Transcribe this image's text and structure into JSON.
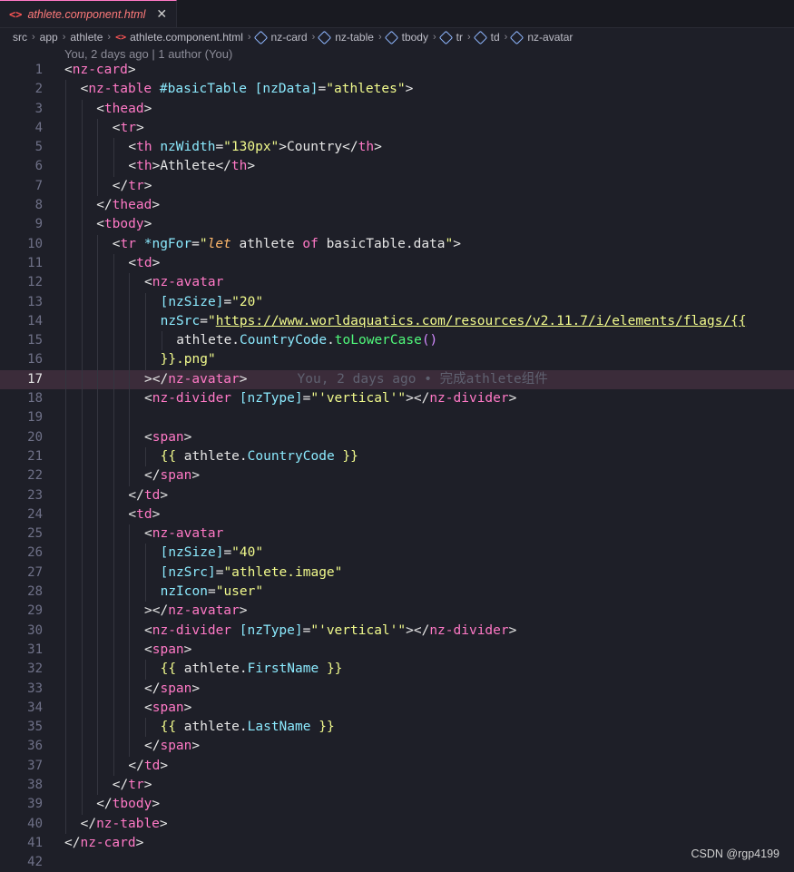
{
  "tab": {
    "icon": "html-icon",
    "name": "athlete.component.html",
    "close": "✕"
  },
  "breadcrumb": [
    "src",
    "app",
    "athlete",
    "athlete.component.html",
    "nz-card",
    "nz-table",
    "tbody",
    "tr",
    "td",
    "nz-avatar"
  ],
  "blame_header": "You, 2 days ago | 1 author (You)",
  "active_line": 17,
  "inline_blame": "You, 2 days ago • 完成athlete组件",
  "lines": [
    {
      "n": "1",
      "indent": 0,
      "tokens": [
        [
          "br",
          "<"
        ],
        [
          "tag",
          "nz-card"
        ],
        [
          "br",
          ">"
        ]
      ]
    },
    {
      "n": "2",
      "indent": 1,
      "tokens": [
        [
          "br",
          "<"
        ],
        [
          "tag",
          "nz-table"
        ],
        [
          "id",
          " "
        ],
        [
          "attr",
          "#basicTable"
        ],
        [
          "id",
          " "
        ],
        [
          "attr",
          "[nzData]"
        ],
        [
          "br",
          "="
        ],
        [
          "str",
          "\"athletes\""
        ],
        [
          "br",
          ">"
        ]
      ]
    },
    {
      "n": "3",
      "indent": 2,
      "tokens": [
        [
          "br",
          "<"
        ],
        [
          "tag",
          "thead"
        ],
        [
          "br",
          ">"
        ]
      ]
    },
    {
      "n": "4",
      "indent": 3,
      "tokens": [
        [
          "br",
          "<"
        ],
        [
          "tag",
          "tr"
        ],
        [
          "br",
          ">"
        ]
      ]
    },
    {
      "n": "5",
      "indent": 4,
      "tokens": [
        [
          "br",
          "<"
        ],
        [
          "tag",
          "th"
        ],
        [
          "id",
          " "
        ],
        [
          "attr",
          "nzWidth"
        ],
        [
          "br",
          "="
        ],
        [
          "str",
          "\"130px\""
        ],
        [
          "br",
          ">"
        ],
        [
          "id",
          "Country"
        ],
        [
          "br",
          "</"
        ],
        [
          "tag",
          "th"
        ],
        [
          "br",
          ">"
        ]
      ]
    },
    {
      "n": "6",
      "indent": 4,
      "tokens": [
        [
          "br",
          "<"
        ],
        [
          "tag",
          "th"
        ],
        [
          "br",
          ">"
        ],
        [
          "id",
          "Athlete"
        ],
        [
          "br",
          "</"
        ],
        [
          "tag",
          "th"
        ],
        [
          "br",
          ">"
        ]
      ]
    },
    {
      "n": "7",
      "indent": 3,
      "tokens": [
        [
          "br",
          "</"
        ],
        [
          "tag",
          "tr"
        ],
        [
          "br",
          ">"
        ]
      ]
    },
    {
      "n": "8",
      "indent": 2,
      "tokens": [
        [
          "br",
          "</"
        ],
        [
          "tag",
          "thead"
        ],
        [
          "br",
          ">"
        ]
      ]
    },
    {
      "n": "9",
      "indent": 2,
      "tokens": [
        [
          "br",
          "<"
        ],
        [
          "tag",
          "tbody"
        ],
        [
          "br",
          ">"
        ]
      ]
    },
    {
      "n": "10",
      "indent": 3,
      "tokens": [
        [
          "br",
          "<"
        ],
        [
          "tag",
          "tr"
        ],
        [
          "id",
          " "
        ],
        [
          "attr",
          "*ngFor"
        ],
        [
          "br",
          "="
        ],
        [
          "str",
          "\""
        ],
        [
          "let",
          "let"
        ],
        [
          "id",
          " athlete "
        ],
        [
          "kw",
          "of"
        ],
        [
          "id",
          " basicTable.data"
        ],
        [
          "str",
          "\""
        ],
        [
          "br",
          ">"
        ]
      ]
    },
    {
      "n": "11",
      "indent": 4,
      "tokens": [
        [
          "br",
          "<"
        ],
        [
          "tag",
          "td"
        ],
        [
          "br",
          ">"
        ]
      ]
    },
    {
      "n": "12",
      "indent": 5,
      "tokens": [
        [
          "br",
          "<"
        ],
        [
          "tag",
          "nz-avatar"
        ]
      ]
    },
    {
      "n": "13",
      "indent": 6,
      "tokens": [
        [
          "attr",
          "[nzSize]"
        ],
        [
          "br",
          "="
        ],
        [
          "str",
          "\"20\""
        ]
      ]
    },
    {
      "n": "14",
      "indent": 6,
      "tokens": [
        [
          "attr",
          "nzSrc"
        ],
        [
          "br",
          "="
        ],
        [
          "str",
          "\""
        ],
        [
          "link",
          "https://www.worldaquatics.com/resources/v2.11.7/i/elements/flags/{{"
        ]
      ]
    },
    {
      "n": "15",
      "indent": 7,
      "tokens": [
        [
          "id",
          "athlete."
        ],
        [
          "attr",
          "CountryCode"
        ],
        [
          "id",
          "."
        ],
        [
          "fn",
          "toLowerCase"
        ],
        [
          "paren",
          "()"
        ]
      ]
    },
    {
      "n": "16",
      "indent": 6,
      "tokens": [
        [
          "curly",
          "}}"
        ],
        [
          "str",
          ".png\""
        ]
      ]
    },
    {
      "n": "17",
      "indent": 5,
      "tokens": [
        [
          "br",
          "></"
        ],
        [
          "tag",
          "nz-avatar"
        ],
        [
          "br",
          ">"
        ]
      ]
    },
    {
      "n": "18",
      "indent": 5,
      "tokens": [
        [
          "br",
          "<"
        ],
        [
          "tag",
          "nz-divider"
        ],
        [
          "id",
          " "
        ],
        [
          "attr",
          "[nzType]"
        ],
        [
          "br",
          "="
        ],
        [
          "str",
          "\"'vertical'\""
        ],
        [
          "br",
          "></"
        ],
        [
          "tag",
          "nz-divider"
        ],
        [
          "br",
          ">"
        ]
      ]
    },
    {
      "n": "19",
      "indent": 5,
      "tokens": []
    },
    {
      "n": "20",
      "indent": 5,
      "tokens": [
        [
          "br",
          "<"
        ],
        [
          "tag",
          "span"
        ],
        [
          "br",
          ">"
        ]
      ]
    },
    {
      "n": "21",
      "indent": 6,
      "tokens": [
        [
          "curly",
          "{{"
        ],
        [
          "id",
          " athlete."
        ],
        [
          "attr",
          "CountryCode"
        ],
        [
          "id",
          " "
        ],
        [
          "curly",
          "}}"
        ]
      ]
    },
    {
      "n": "22",
      "indent": 5,
      "tokens": [
        [
          "br",
          "</"
        ],
        [
          "tag",
          "span"
        ],
        [
          "br",
          ">"
        ]
      ]
    },
    {
      "n": "23",
      "indent": 4,
      "tokens": [
        [
          "br",
          "</"
        ],
        [
          "tag",
          "td"
        ],
        [
          "br",
          ">"
        ]
      ]
    },
    {
      "n": "24",
      "indent": 4,
      "tokens": [
        [
          "br",
          "<"
        ],
        [
          "tag",
          "td"
        ],
        [
          "br",
          ">"
        ]
      ]
    },
    {
      "n": "25",
      "indent": 5,
      "tokens": [
        [
          "br",
          "<"
        ],
        [
          "tag",
          "nz-avatar"
        ]
      ]
    },
    {
      "n": "26",
      "indent": 6,
      "tokens": [
        [
          "attr",
          "[nzSize]"
        ],
        [
          "br",
          "="
        ],
        [
          "str",
          "\"40\""
        ]
      ]
    },
    {
      "n": "27",
      "indent": 6,
      "tokens": [
        [
          "attr",
          "[nzSrc]"
        ],
        [
          "br",
          "="
        ],
        [
          "str",
          "\"athlete.image\""
        ]
      ]
    },
    {
      "n": "28",
      "indent": 6,
      "tokens": [
        [
          "attr",
          "nzIcon"
        ],
        [
          "br",
          "="
        ],
        [
          "str",
          "\"user\""
        ]
      ]
    },
    {
      "n": "29",
      "indent": 5,
      "tokens": [
        [
          "br",
          "></"
        ],
        [
          "tag",
          "nz-avatar"
        ],
        [
          "br",
          ">"
        ]
      ]
    },
    {
      "n": "30",
      "indent": 5,
      "tokens": [
        [
          "br",
          "<"
        ],
        [
          "tag",
          "nz-divider"
        ],
        [
          "id",
          " "
        ],
        [
          "attr",
          "[nzType]"
        ],
        [
          "br",
          "="
        ],
        [
          "str",
          "\"'vertical'\""
        ],
        [
          "br",
          "></"
        ],
        [
          "tag",
          "nz-divider"
        ],
        [
          "br",
          ">"
        ]
      ]
    },
    {
      "n": "31",
      "indent": 5,
      "tokens": [
        [
          "br",
          "<"
        ],
        [
          "tag",
          "span"
        ],
        [
          "br",
          ">"
        ]
      ]
    },
    {
      "n": "32",
      "indent": 6,
      "tokens": [
        [
          "curly",
          "{{"
        ],
        [
          "id",
          " athlete."
        ],
        [
          "attr",
          "FirstName"
        ],
        [
          "id",
          " "
        ],
        [
          "curly",
          "}}"
        ]
      ]
    },
    {
      "n": "33",
      "indent": 5,
      "tokens": [
        [
          "br",
          "</"
        ],
        [
          "tag",
          "span"
        ],
        [
          "br",
          ">"
        ]
      ]
    },
    {
      "n": "34",
      "indent": 5,
      "tokens": [
        [
          "br",
          "<"
        ],
        [
          "tag",
          "span"
        ],
        [
          "br",
          ">"
        ]
      ]
    },
    {
      "n": "35",
      "indent": 6,
      "tokens": [
        [
          "curly",
          "{{"
        ],
        [
          "id",
          " athlete."
        ],
        [
          "attr",
          "LastName"
        ],
        [
          "id",
          " "
        ],
        [
          "curly",
          "}}"
        ]
      ]
    },
    {
      "n": "36",
      "indent": 5,
      "tokens": [
        [
          "br",
          "</"
        ],
        [
          "tag",
          "span"
        ],
        [
          "br",
          ">"
        ]
      ]
    },
    {
      "n": "37",
      "indent": 4,
      "tokens": [
        [
          "br",
          "</"
        ],
        [
          "tag",
          "td"
        ],
        [
          "br",
          ">"
        ]
      ]
    },
    {
      "n": "38",
      "indent": 3,
      "tokens": [
        [
          "br",
          "</"
        ],
        [
          "tag",
          "tr"
        ],
        [
          "br",
          ">"
        ]
      ]
    },
    {
      "n": "39",
      "indent": 2,
      "tokens": [
        [
          "br",
          "</"
        ],
        [
          "tag",
          "tbody"
        ],
        [
          "br",
          ">"
        ]
      ]
    },
    {
      "n": "40",
      "indent": 1,
      "tokens": [
        [
          "br",
          "</"
        ],
        [
          "tag",
          "nz-table"
        ],
        [
          "br",
          ">"
        ]
      ]
    },
    {
      "n": "41",
      "indent": 0,
      "tokens": [
        [
          "br",
          "</"
        ],
        [
          "tag",
          "nz-card"
        ],
        [
          "br",
          ">"
        ]
      ]
    },
    {
      "n": "42",
      "indent": 0,
      "tokens": []
    }
  ],
  "watermark": "CSDN @rgp4199"
}
